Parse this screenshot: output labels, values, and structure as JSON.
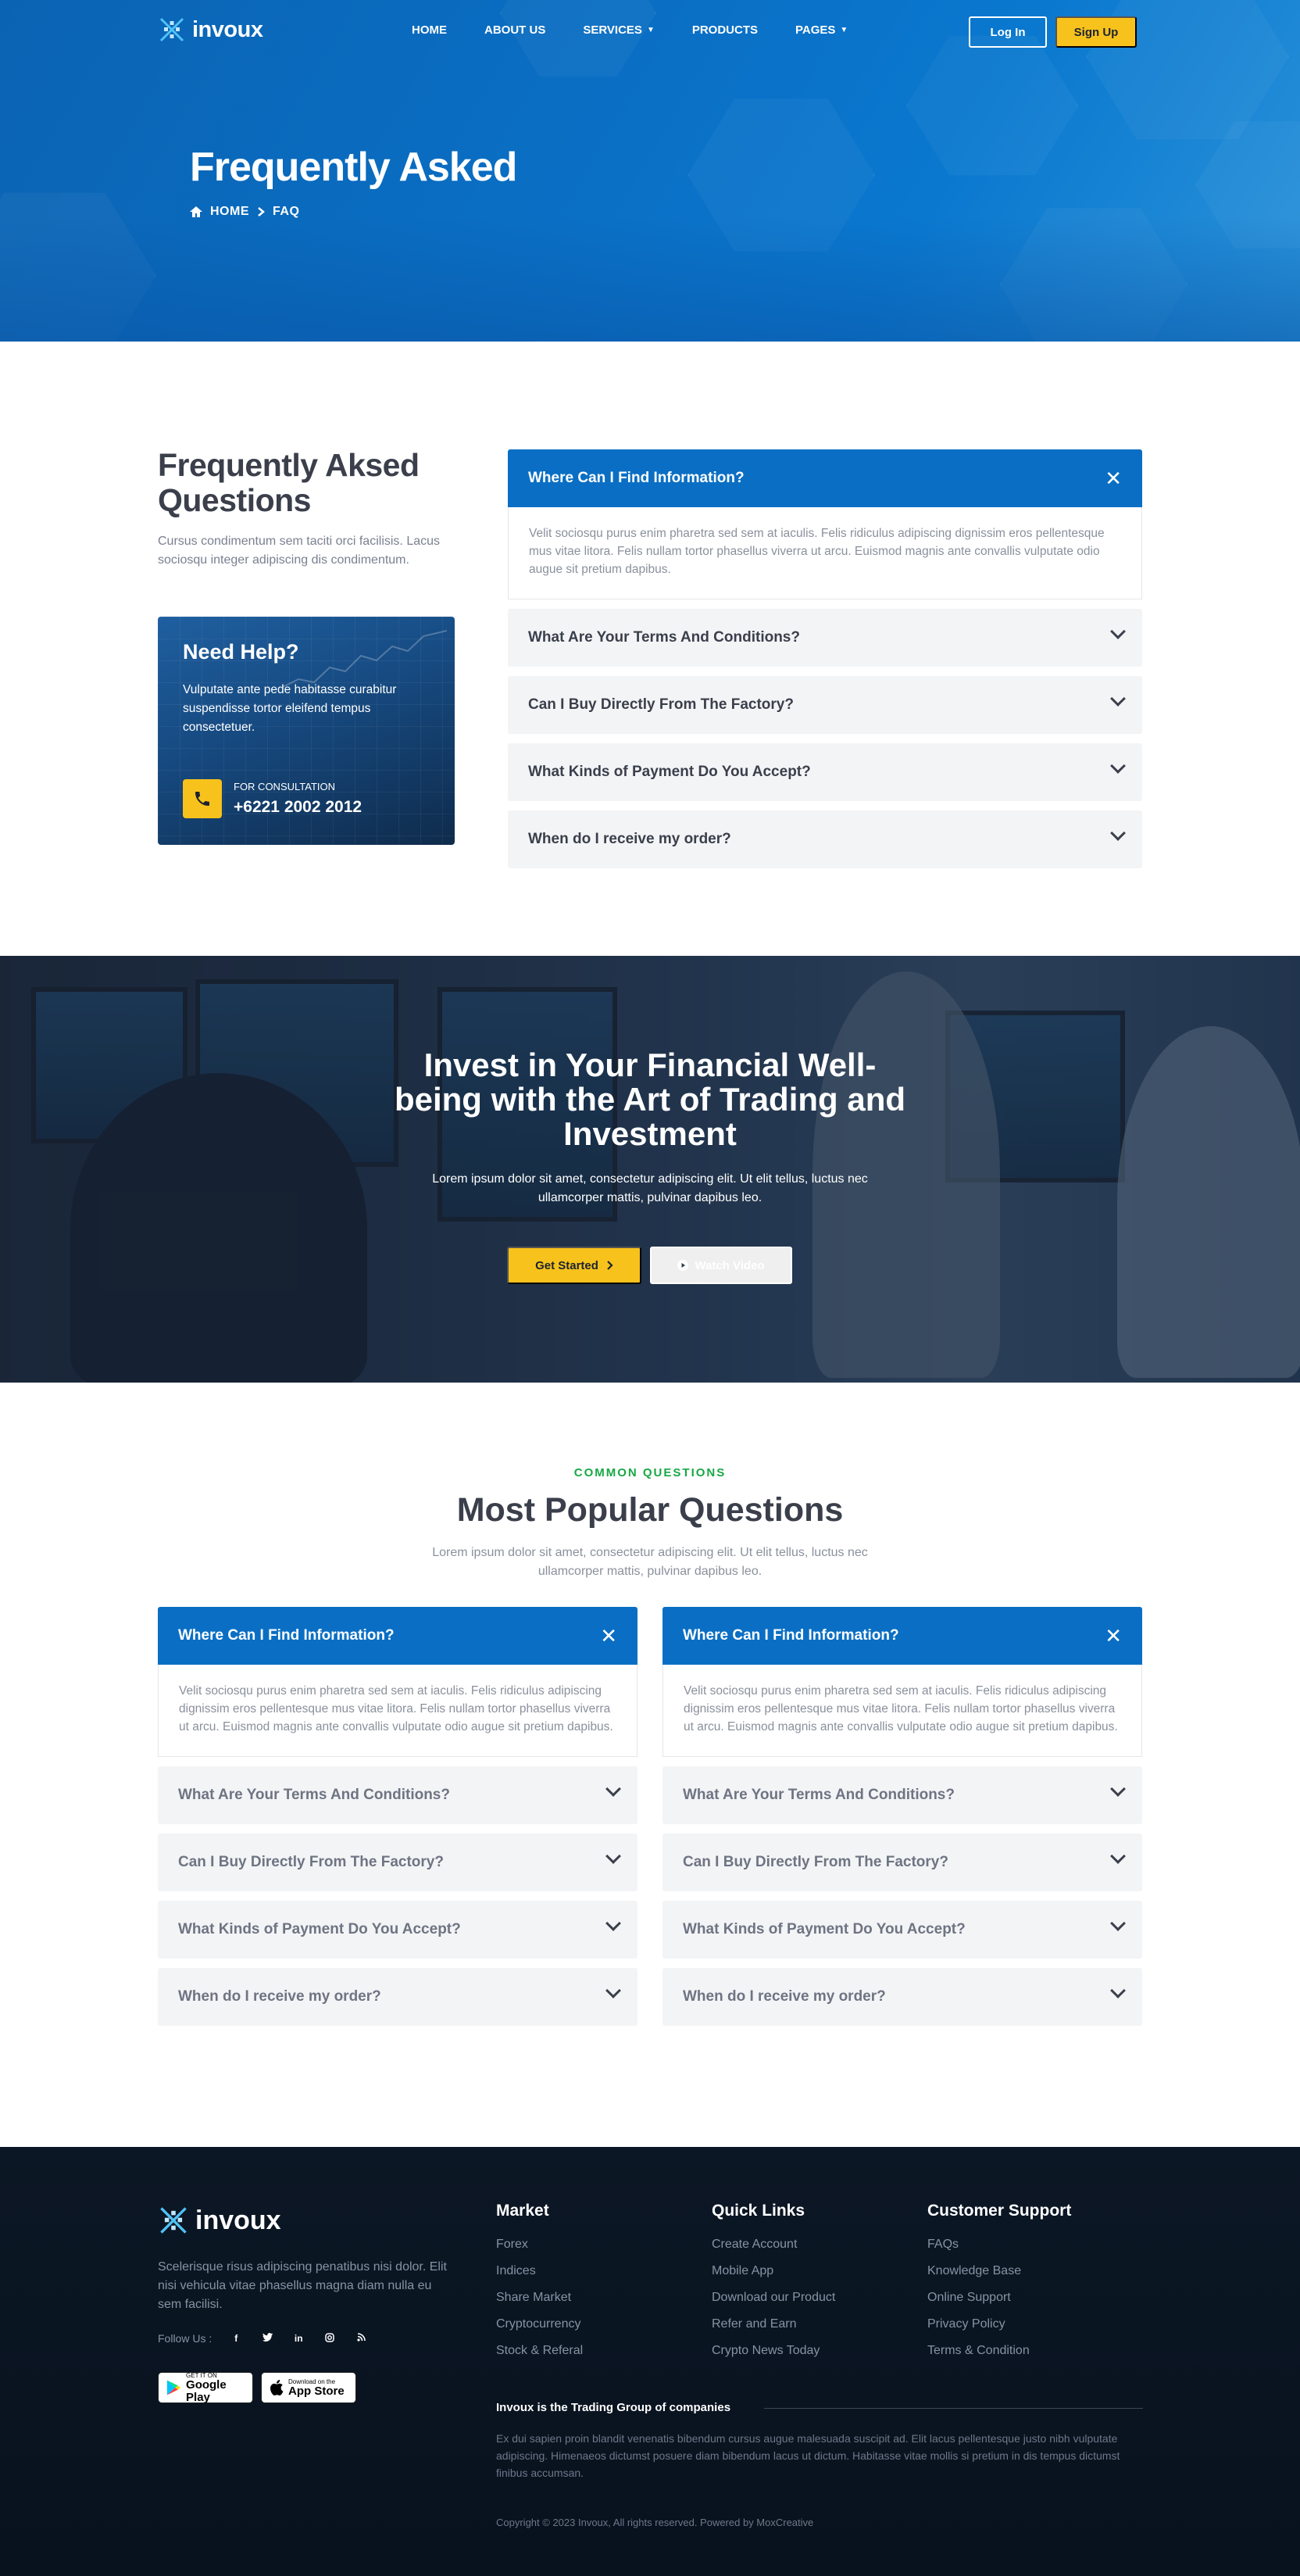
{
  "brand": {
    "name": "invoux",
    "accent": "#0a6fc4",
    "yellow": "#f7c21b",
    "green": "#17a844"
  },
  "nav": {
    "items": [
      {
        "label": "HOME",
        "has_dropdown": false
      },
      {
        "label": "ABOUT US",
        "has_dropdown": false
      },
      {
        "label": "SERVICES",
        "has_dropdown": true
      },
      {
        "label": "PRODUCTS",
        "has_dropdown": false
      },
      {
        "label": "PAGES",
        "has_dropdown": true
      }
    ],
    "login_label": "Log In",
    "signup_label": "Sign Up"
  },
  "hero": {
    "title": "Frequently Asked",
    "breadcrumb": [
      "HOME",
      "FAQ"
    ]
  },
  "faq_section": {
    "title": "Frequently Aksed Questions",
    "subtitle": "Cursus condimentum sem taciti orci facilisis. Lacus sociosqu integer adipiscing dis condimentum.",
    "help": {
      "title": "Need Help?",
      "text": "Vulputate ante pede habitasse curabitur suspendisse tortor eleifend tempus consectetuer.",
      "consultation_label": "FOR CONSULTATION",
      "phone": "+6221 2002 2012"
    },
    "open_question": "Where Can I Find Information?",
    "open_answer": "Velit sociosqu purus enim pharetra sed sem at iaculis. Felis ridiculus adipiscing dignissim eros pellentesque mus vitae litora. Felis nullam tortor phasellus viverra ut arcu. Euismod magnis ante convallis vulputate odio augue sit pretium dapibus.",
    "questions": [
      "What Are Your Terms And Conditions?",
      "Can I Buy Directly From The Factory?",
      "What Kinds of Payment Do You Accept?",
      "When do I receive my order?"
    ]
  },
  "cta": {
    "title_line1": "Invest in Your Financial Well-",
    "title_line2": "being with the Art of Trading and",
    "title_line3": "Investment",
    "text_line1": "Lorem ipsum dolor sit amet, consectetur adipiscing elit. Ut elit tellus, luctus nec",
    "text_line2": "ullamcorper mattis, pulvinar dapibus leo.",
    "get_started_label": "Get Started",
    "watch_video_label": "Watch Video"
  },
  "popular": {
    "eyebrow": "COMMON QUESTIONS",
    "title": "Most Popular Questions",
    "lead_line1": "Lorem ipsum dolor sit amet, consectetur adipiscing elit. Ut elit tellus, luctus nec",
    "lead_line2": "ullamcorper mattis, pulvinar dapibus leo.",
    "left": {
      "open_question": "Where Can I Find Information?",
      "open_answer": "Velit sociosqu purus enim pharetra sed sem at iaculis. Felis ridiculus adipiscing dignissim eros pellentesque mus vitae litora. Felis nullam tortor phasellus viverra ut arcu. Euismod magnis ante convallis vulputate odio augue sit pretium dapibus.",
      "questions": [
        "What Are Your Terms And Conditions?",
        "Can I Buy Directly From The Factory?",
        "What Kinds of Payment Do You Accept?",
        "When do I receive my order?"
      ]
    },
    "right": {
      "open_question": "Where Can I Find Information?",
      "open_answer": "Velit sociosqu purus enim pharetra sed sem at iaculis. Felis ridiculus adipiscing dignissim eros pellentesque mus vitae litora. Felis nullam tortor phasellus viverra ut arcu. Euismod magnis ante convallis vulputate odio augue sit pretium dapibus.",
      "questions": [
        "What Are Your Terms And Conditions?",
        "Can I Buy Directly From The Factory?",
        "What Kinds of Payment Do You Accept?",
        "When do I receive my order?"
      ]
    }
  },
  "footer": {
    "logo": "invoux",
    "description": "Scelerisque risus adipiscing penatibus nisi dolor. Elit nisi vehicula vitae phasellus magna diam nulla eu sem facilisi.",
    "follow_label": "Follow Us :",
    "socials": [
      "f",
      "t",
      "in",
      "ig",
      "rss"
    ],
    "google_play": {
      "small": "GET IT ON",
      "big": "Google Play"
    },
    "app_store": {
      "small": "Download on the",
      "big": "App Store"
    },
    "columns": [
      {
        "title": "Market",
        "links": [
          "Forex",
          "Indices",
          "Share Market",
          "Cryptocurrency",
          "Stock & Referal"
        ]
      },
      {
        "title": "Quick Links",
        "links": [
          "Create Account",
          "Mobile App",
          "Download our Product",
          "Refer and Earn",
          "Crypto News Today"
        ]
      },
      {
        "title": "Customer Support",
        "links": [
          "FAQs",
          "Knowledge Base",
          "Online Support",
          "Privacy Policy",
          "Terms & Condition"
        ]
      }
    ],
    "group_title": "Invoux is the Trading Group of companies",
    "group_text": "Ex dui sapien proin blandit venenatis bibendum cursus augue malesuada suscipit ad. Elit lacus pellentesque justo nibh vulputate adipiscing. Himenaeos dictumst posuere diam bibendum lacus ut dictum. Habitasse vitae mollis si pretium in dis tempus dictumst finibus accumsan.",
    "copyright": "Copyright © 2023 Invoux, All rights reserved. Powered by MoxCreative"
  }
}
